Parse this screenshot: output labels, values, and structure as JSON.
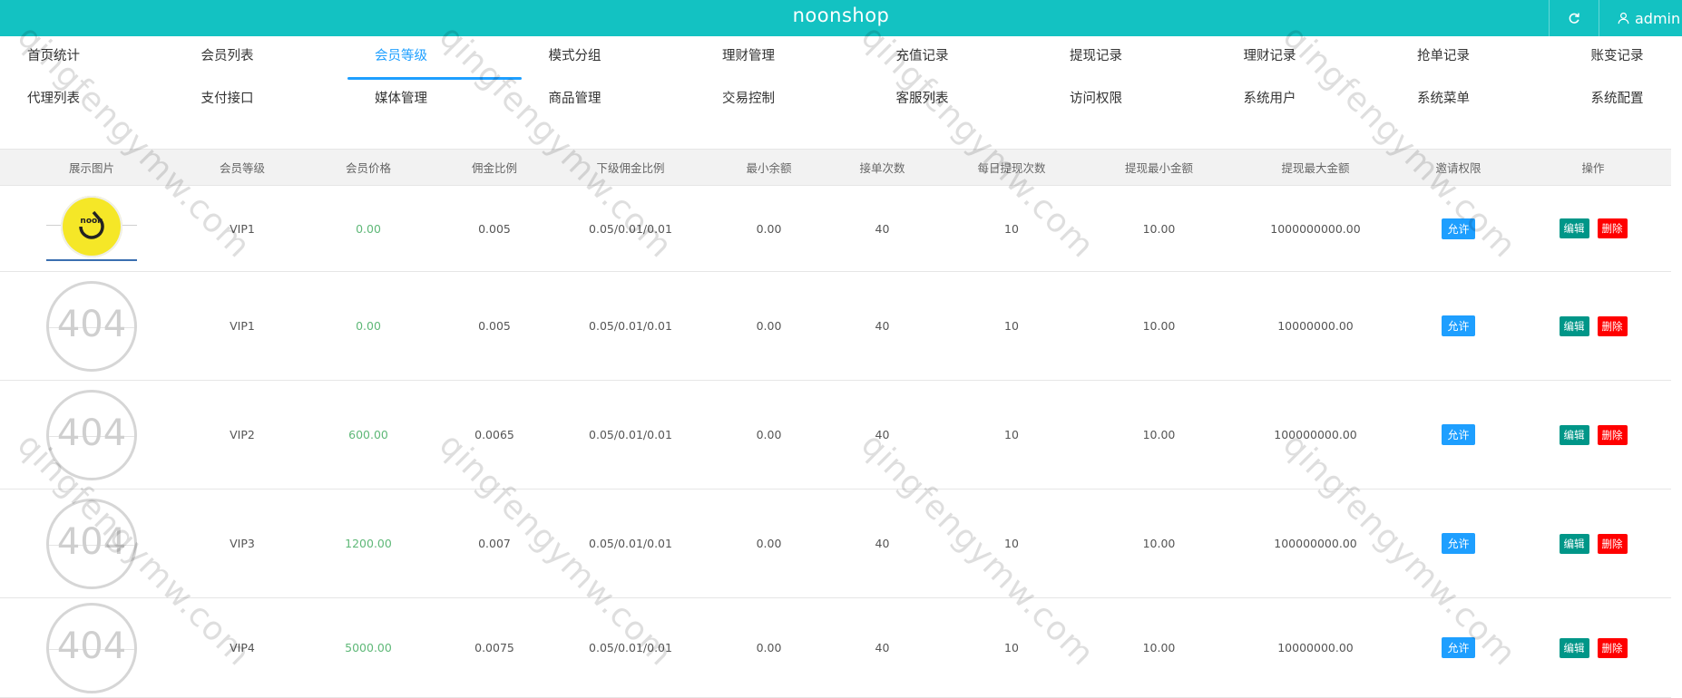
{
  "app": {
    "brand": "noonshop",
    "user": "admin"
  },
  "nav": [
    [
      "首页统计",
      "会员列表",
      "会员等级",
      "模式分组",
      "理财管理",
      "充值记录",
      "提现记录",
      "理财记录",
      "抢单记录",
      "账变记录"
    ],
    [
      "代理列表",
      "支付接口",
      "媒体管理",
      "商品管理",
      "交易控制",
      "客服列表",
      "访问权限",
      "系统用户",
      "系统菜单",
      "系统配置"
    ]
  ],
  "active_nav": "会员等级",
  "table": {
    "headers": [
      "展示图片",
      "会员等级",
      "会员价格",
      "佣金比例",
      "下级佣金比例",
      "最小余额",
      "接单次数",
      "每日提现次数",
      "提现最小金额",
      "提现最大金额",
      "邀请权限",
      "操作"
    ],
    "rows": [
      {
        "image": "logo",
        "level": "VIP1",
        "price": "0.00",
        "rate": "0.005",
        "sub_rate": "0.05/0.01/0.01",
        "min_balance": "0.00",
        "orders": "40",
        "daily_withdraw": "10",
        "withdraw_min": "10.00",
        "withdraw_max": "1000000000.00",
        "invite": "允许",
        "edit": "编辑",
        "delete": "删除"
      },
      {
        "image": "404",
        "level": "VIP1",
        "price": "0.00",
        "rate": "0.005",
        "sub_rate": "0.05/0.01/0.01",
        "min_balance": "0.00",
        "orders": "40",
        "daily_withdraw": "10",
        "withdraw_min": "10.00",
        "withdraw_max": "10000000.00",
        "invite": "允许",
        "edit": "编辑",
        "delete": "删除"
      },
      {
        "image": "404",
        "level": "VIP2",
        "price": "600.00",
        "rate": "0.0065",
        "sub_rate": "0.05/0.01/0.01",
        "min_balance": "0.00",
        "orders": "40",
        "daily_withdraw": "10",
        "withdraw_min": "10.00",
        "withdraw_max": "100000000.00",
        "invite": "允许",
        "edit": "编辑",
        "delete": "删除"
      },
      {
        "image": "404",
        "level": "VIP3",
        "price": "1200.00",
        "rate": "0.007",
        "sub_rate": "0.05/0.01/0.01",
        "min_balance": "0.00",
        "orders": "40",
        "daily_withdraw": "10",
        "withdraw_min": "10.00",
        "withdraw_max": "100000000.00",
        "invite": "允许",
        "edit": "编辑",
        "delete": "删除"
      },
      {
        "image": "404",
        "level": "VIP4",
        "price": "5000.00",
        "rate": "0.0075",
        "sub_rate": "0.05/0.01/0.01",
        "min_balance": "0.00",
        "orders": "40",
        "daily_withdraw": "10",
        "withdraw_min": "10.00",
        "withdraw_max": "10000000.00",
        "invite": "允许",
        "edit": "编辑",
        "delete": "删除"
      }
    ]
  },
  "placeholder_image_text": "404",
  "logo_text": "noon",
  "watermark": "qingfengymw.com",
  "colors": {
    "topbar": "#13c2c2",
    "active": "#1e9fff",
    "price": "#5fb878",
    "allow": "#1e9fff",
    "edit": "#009688",
    "delete": "#ff0000"
  },
  "icons": {
    "refresh": "refresh-icon",
    "user": "user-icon"
  }
}
